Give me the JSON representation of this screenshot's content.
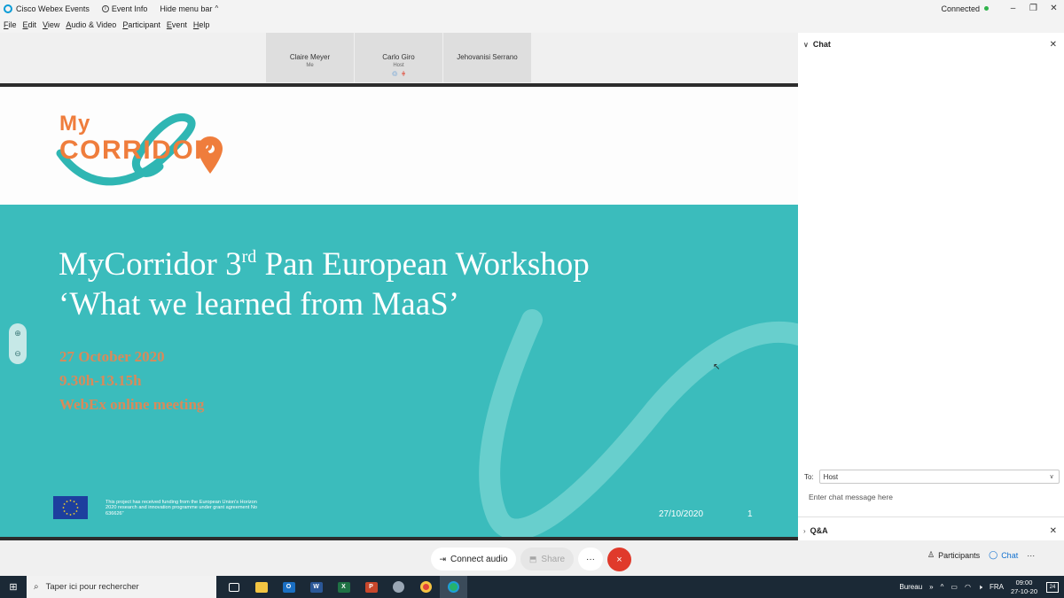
{
  "titlebar": {
    "app_name": "Cisco Webex Events",
    "event_info": "Event Info",
    "hide_menu": "Hide menu bar",
    "status": "Connected"
  },
  "menu": [
    "File",
    "Edit",
    "View",
    "Audio & Video",
    "Participant",
    "Event",
    "Help"
  ],
  "participants": [
    {
      "name": "Claire Meyer",
      "role": "Me"
    },
    {
      "name": "Carlo Giro",
      "role": "Host"
    },
    {
      "name": "Jehovanisi Serrano",
      "role": ""
    }
  ],
  "slide": {
    "logo_my": "My",
    "logo_corridor": "CORRIDOR",
    "title_line1_pre": "MyCorridor 3",
    "title_line1_sup": "rd",
    "title_line1_post": " Pan European Workshop",
    "title_line2": "‘What we learned from MaaS’",
    "date": "27 October 2020",
    "time": "9.30h-13.15h",
    "venue": "WebEx online meeting",
    "funding": "This project has received funding from the European Union's Horizon 2020 research and innovation programme under grant agreement No 636626”",
    "footer_date": "27/10/2020",
    "page_number": "1"
  },
  "chat": {
    "title": "Chat",
    "to_label": "To:",
    "to_value": "Host",
    "input_placeholder": "Enter chat message here",
    "qa_title": "Q&A"
  },
  "controls": {
    "connect_audio": "Connect audio",
    "share": "Share",
    "more": "···",
    "end": "×",
    "participants": "Participants",
    "chat": "Chat",
    "overflow": "···"
  },
  "taskbar": {
    "search_placeholder": "Taper ici pour rechercher",
    "desktop_label": "Bureau",
    "language": "FRA",
    "time": "09:00",
    "date": "27-10-20",
    "notifications": "24"
  },
  "colors": {
    "teal": "#3bbcbc",
    "orange": "#ef7d3c",
    "end_red": "#e03a2b",
    "accent_blue": "#1170cf"
  }
}
